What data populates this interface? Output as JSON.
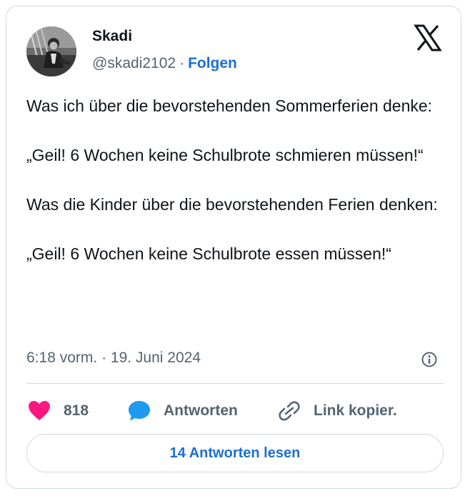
{
  "author": {
    "name": "Skadi",
    "handle": "@skadi2102",
    "separator": "·",
    "follow_label": "Folgen",
    "avatar_icon": "profile-photo"
  },
  "brand": {
    "logo_icon": "x-logo"
  },
  "tweet": {
    "paragraphs": [
      "Was ich über die bevorstehenden Sommerferien denke:",
      "„Geil! 6 Wochen keine Schulbrote schmieren müssen!“",
      "Was die Kinder über die bevorstehenden Ferien denken:",
      "„Geil! 6 Wochen keine Schulbrote essen müssen!“"
    ],
    "time": "6:18 vorm.",
    "separator": "·",
    "date": "19. Juni 2024",
    "info_icon": "info-icon"
  },
  "actions": {
    "like_count": "818",
    "reply_label": "Antworten",
    "link_label": "Link kopier.",
    "read_replies_label": "14 Antworten lesen"
  },
  "colors": {
    "like": "#f91880",
    "reply": "#1d9bf0",
    "link_accent": "#1c6fd1",
    "secondary_text": "#536471",
    "border": "#cfd9de"
  }
}
